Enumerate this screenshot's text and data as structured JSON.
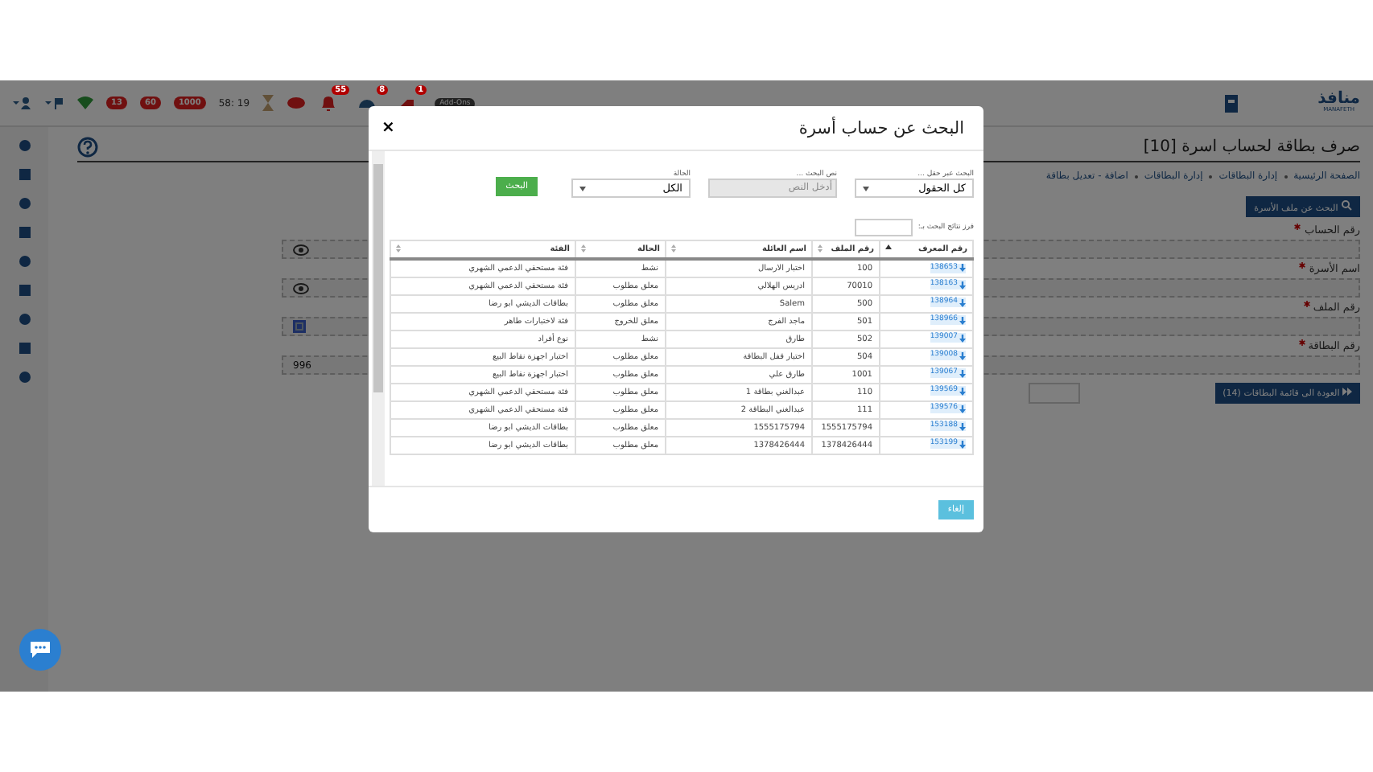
{
  "top_bar": {
    "brand": "منافذ",
    "brand_sub": "MANAFETH",
    "addons": "Add-Ons",
    "alerts": [
      {
        "kind": "tag",
        "count": "1"
      },
      {
        "kind": "gauge",
        "count": "8"
      },
      {
        "kind": "bell",
        "count": "55"
      }
    ],
    "timer": "58: 19",
    "counters": [
      "1000",
      "60",
      "13"
    ]
  },
  "page": {
    "title": "صرف بطاقة لحساب اسرة [10]",
    "breadcrumb": [
      "الصفحة الرئيسية",
      "إدارة البطاقات",
      "إدارة البطاقات",
      "اضافة - تعديل بطاقة"
    ],
    "search_button": "البحث عن ملف الأسرة",
    "fields": [
      {
        "label": "رقم الحساب",
        "required": true,
        "kind": "eye"
      },
      {
        "label": "اسم الأسرة",
        "required": true,
        "kind": "eye"
      },
      {
        "label": "رقم الملف",
        "required": true,
        "kind": "check"
      },
      {
        "label": "رقم البطاقة",
        "required": true,
        "value": "996",
        "kind": "plain"
      }
    ],
    "back_button": "العودة الى قائمة البطاقات (14)"
  },
  "modal": {
    "title": "البحث عن حساب أسرة",
    "close": "×",
    "filters": [
      {
        "label": "البحث عبر حقل ...",
        "kind": "select",
        "value": "كل الحقول",
        "disabled": false
      },
      {
        "label": "نص البحث ...",
        "kind": "input",
        "placeholder": "أدخل النص",
        "disabled": true
      },
      {
        "label": "الحالة",
        "kind": "select",
        "value": "الكل",
        "disabled": false
      }
    ],
    "search_button": "البحث",
    "sort_label": "فرز نتائج البحث بـ:",
    "table": {
      "columns": [
        {
          "label": "رقم المعرف",
          "sorted": true
        },
        {
          "label": "رقم الملف",
          "sorted": false
        },
        {
          "label": "اسم العائلة",
          "sorted": false
        },
        {
          "label": "الحالة",
          "sorted": false
        },
        {
          "label": "الفئة",
          "sorted": false
        }
      ],
      "rows": [
        [
          "138653",
          "100",
          "اختبار الارسال",
          "نشط",
          "فئة مستحقي الدعمي الشهري"
        ],
        [
          "138163",
          "70010",
          "ادريس الهلالي",
          "معلق مطلوب",
          "فئة مستحقي الدعمي الشهري"
        ],
        [
          "138964",
          "500",
          "Salem",
          "معلق مطلوب",
          "بطاقات الديشي ابو رضا"
        ],
        [
          "138966",
          "501",
          "ماجد الفرج",
          "معلق للخروج",
          "فئة لاختبارات طاهر"
        ],
        [
          "139007",
          "502",
          "طارق",
          "نشط",
          "نوع أفراد"
        ],
        [
          "139008",
          "504",
          "اختبار قفل البطاقة",
          "معلق مطلوب",
          "اختبار اجهزة نقاط البيع"
        ],
        [
          "139067",
          "1001",
          "طارق علي",
          "معلق مطلوب",
          "اختبار اجهزة نقاط البيع"
        ],
        [
          "139569",
          "110",
          "عبدالغني بطاقة 1",
          "معلق مطلوب",
          "فئة مستحقي الدعمي الشهري"
        ],
        [
          "139576",
          "111",
          "عبدالغني البطاقة 2",
          "معلق مطلوب",
          "فئة مستحقي الدعمي الشهري"
        ],
        [
          "153188",
          "1555175794",
          "1555175794",
          "معلق مطلوب",
          "بطاقات الديشي ابو رضا"
        ],
        [
          "153199",
          "1378426444",
          "1378426444",
          "معلق مطلوب",
          "بطاقات الديشي ابو رضا"
        ]
      ]
    },
    "cancel_button": "إلغاء"
  }
}
